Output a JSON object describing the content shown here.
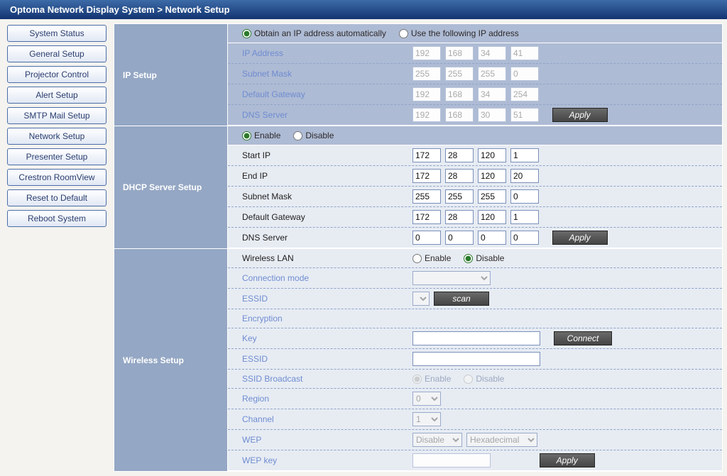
{
  "header": {
    "breadcrumb": "Optoma Network Display System > Network Setup"
  },
  "sidebar": {
    "items": [
      {
        "label": "System Status"
      },
      {
        "label": "General Setup"
      },
      {
        "label": "Projector Control"
      },
      {
        "label": "Alert Setup"
      },
      {
        "label": "SMTP Mail Setup"
      },
      {
        "label": "Network Setup"
      },
      {
        "label": "Presenter Setup"
      },
      {
        "label": "Crestron RoomView"
      },
      {
        "label": "Reset to Default"
      },
      {
        "label": "Reboot System"
      }
    ]
  },
  "ip_setup": {
    "title": "IP Setup",
    "mode_auto": "Obtain an IP address automatically",
    "mode_manual": "Use the following IP address",
    "rows": {
      "ip": {
        "label": "IP Address",
        "o": [
          "192",
          "168",
          "34",
          "41"
        ]
      },
      "subnet": {
        "label": "Subnet Mask",
        "o": [
          "255",
          "255",
          "255",
          "0"
        ]
      },
      "gateway": {
        "label": "Default Gateway",
        "o": [
          "192",
          "168",
          "34",
          "254"
        ]
      },
      "dns": {
        "label": "DNS Server",
        "o": [
          "192",
          "168",
          "30",
          "51"
        ]
      }
    },
    "apply": "Apply"
  },
  "dhcp": {
    "title": "DHCP Server Setup",
    "enable": "Enable",
    "disable": "Disable",
    "rows": {
      "start": {
        "label": "Start IP",
        "o": [
          "172",
          "28",
          "120",
          "1"
        ]
      },
      "end": {
        "label": "End IP",
        "o": [
          "172",
          "28",
          "120",
          "20"
        ]
      },
      "subnet": {
        "label": "Subnet Mask",
        "o": [
          "255",
          "255",
          "255",
          "0"
        ]
      },
      "gateway": {
        "label": "Default Gateway",
        "o": [
          "172",
          "28",
          "120",
          "1"
        ]
      },
      "dns": {
        "label": "DNS Server",
        "o": [
          "0",
          "0",
          "0",
          "0"
        ]
      }
    },
    "apply": "Apply"
  },
  "wifi": {
    "title": "Wireless Setup",
    "wlan_label": "Wireless LAN",
    "enable": "Enable",
    "disable": "Disable",
    "conn_mode": "Connection mode",
    "essid": "ESSID",
    "scan": "scan",
    "encryption": "Encryption",
    "key": "Key",
    "connect": "Connect",
    "essid2": "ESSID",
    "ssid_broadcast": "SSID Broadcast",
    "region": "Region",
    "region_val": "0",
    "channel": "Channel",
    "channel_val": "1",
    "wep": "WEP",
    "wep_mode": "Disable",
    "wep_fmt": "Hexadecimal",
    "wep_key": "WEP key",
    "apply": "Apply"
  }
}
